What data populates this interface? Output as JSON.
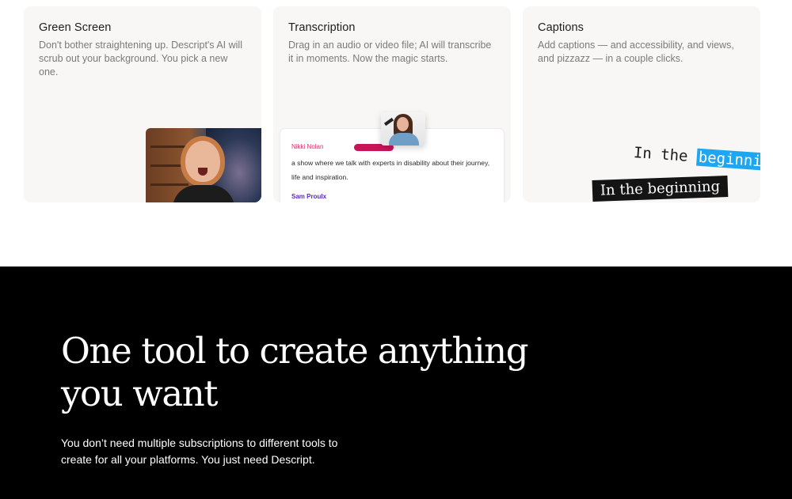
{
  "cards": [
    {
      "title": "Green Screen",
      "description": "Don't bother straightening up. Descript's AI will scrub out your background. You pick a new one."
    },
    {
      "title": "Transcription",
      "description": "Drag in an audio or video file; AI will transcribe it in moments. Now the magic starts.",
      "transcript": {
        "speaker_1": "Nikki Nolan",
        "text": "a show where we talk with experts in disability about their journey, life and inspiration.",
        "speaker_2": "Sam Proulx"
      }
    },
    {
      "title": "Captions",
      "description": "Add captions — and accessibility, and views, and pizzazz — in a couple clicks.",
      "caption_sample_1_prefix": "In the",
      "caption_sample_1_highlight": "beginning",
      "caption_sample_2": "In the beginning",
      "highlight_color": "#1ea6f0"
    }
  ],
  "hero": {
    "title": "One tool to create anything you want",
    "subtitle": "You don’t need multiple subscriptions to different tools to create for all your platforms. You just need Descript."
  },
  "colors": {
    "card_bg": "#f8f7f5",
    "speaker_1": "#d2336d",
    "speaker_2": "#5b28c8",
    "playhead": "#c7155a",
    "hero_bg": "#000000"
  }
}
